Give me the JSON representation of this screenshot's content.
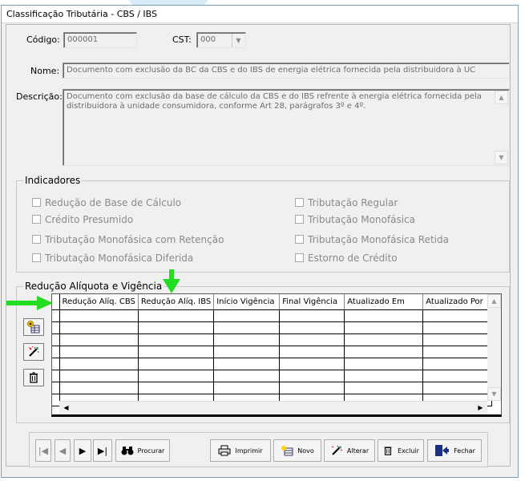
{
  "window": {
    "title": "Classificação Tributária - CBS / IBS"
  },
  "form": {
    "codigo_label": "Código:",
    "codigo_value": "000001",
    "cst_label": "CST:",
    "cst_value": "000",
    "nome_label": "Nome:",
    "nome_value": "Documento com exclusão da BC da CBS e do IBS de energia elétrica fornecida pela distribuidora à UC",
    "descricao_label": "Descrição:",
    "descricao_value": "Documento com exclusão da base de cálculo da CBS e do IBS refrente à energia elétrica fornecida pela distribuidora à unidade consumidora, conforme Art 28, parágrafos 3º e 4º."
  },
  "indicadores": {
    "legend": "Indicadores",
    "items": [
      {
        "label": "Redução de Base de Cálculo",
        "checked": false
      },
      {
        "label": "Tributação Regular",
        "checked": false
      },
      {
        "label": "Crédito Presumido",
        "checked": false
      },
      {
        "label": "Tributação Monofásica",
        "checked": false
      },
      {
        "label": "Tributação Monofásica com Retenção",
        "checked": false
      },
      {
        "label": "Tributação Monofásica Retida",
        "checked": false
      },
      {
        "label": "Tributação Monofásica Diferida",
        "checked": false
      },
      {
        "label": "Estorno de Crédito",
        "checked": false
      }
    ]
  },
  "reducao": {
    "legend": "Redução Alíquota e Vigência",
    "columns": [
      "Redução Alíq. CBS",
      "Redução Alíq. IBS",
      "Início Vigência",
      "Final Vigência",
      "Atualizado Em",
      "Atualizado Por"
    ],
    "side_buttons": [
      {
        "name": "add-row-icon"
      },
      {
        "name": "edit-row-icon"
      },
      {
        "name": "trash-icon"
      }
    ]
  },
  "toolbar": {
    "procurar": "Procurar",
    "imprimir": "Imprimir",
    "novo": "Novo",
    "alterar": "Alterar",
    "excluir": "Excluir",
    "fechar": "Fechar"
  },
  "colors": {
    "annotation_arrow": "#22dd22",
    "window_border": "#7a9cc0",
    "field_text": "#6d6d6d"
  }
}
